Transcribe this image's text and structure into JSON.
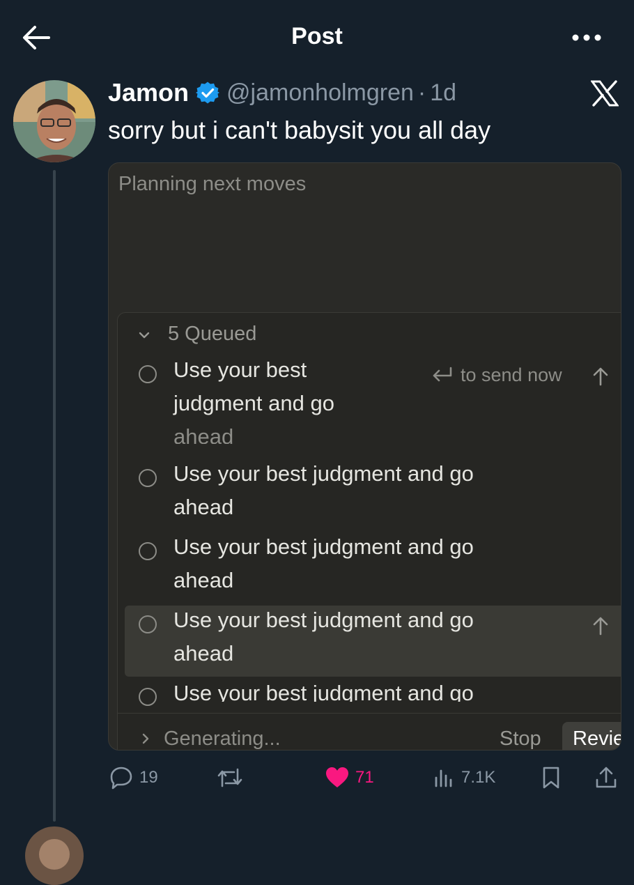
{
  "header": {
    "title": "Post"
  },
  "post": {
    "author_name": "Jamon",
    "handle": "@jamonholmgren",
    "separator": "·",
    "time": "1d",
    "text": "sorry but i can't babysit you all day"
  },
  "media": {
    "planning_label": "Planning next moves",
    "queue_label": "5 Queued",
    "send_hint": "to send now",
    "items": [
      {
        "text": "Use your best judgment and go ahead"
      },
      {
        "text": "Use your best judgment and go ahead"
      },
      {
        "text": "Use your best judgment and go ahead"
      },
      {
        "text": "Use your best judgment and go ahead"
      },
      {
        "text": "Use your best judgment and go"
      }
    ],
    "item1_lines": [
      "Use your best",
      "judgment and go",
      "ahead"
    ],
    "status": "Generating...",
    "stop_label": "Stop",
    "review_label": "Revie"
  },
  "actions": {
    "replies": "19",
    "reposts": "",
    "likes": "71",
    "views": "7.1K"
  },
  "colors": {
    "background": "#15202b",
    "verified": "#1d9bf0",
    "like": "#f91880",
    "muted": "#8b98a5"
  },
  "icons": [
    "back-arrow-icon",
    "more-icon",
    "verified-badge-icon",
    "x-logo-icon",
    "reply-icon",
    "repost-icon",
    "heart-icon",
    "views-icon",
    "bookmark-icon",
    "share-icon"
  ]
}
